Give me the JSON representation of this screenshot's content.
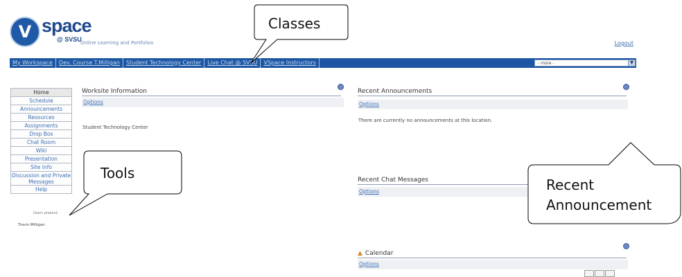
{
  "header": {
    "logo_mark": "V",
    "logo_main": "space",
    "logo_sub": "@ SVSU",
    "logo_tagline": "Online Learning and Portfolios",
    "logout": "Logout"
  },
  "site_tabs": [
    "My Workspace",
    "Dev. Course T.Milligan",
    "Student Technology Center",
    "Live Chat @ SVSU",
    "VSpace Instructors"
  ],
  "more_select": {
    "selected": "- more -"
  },
  "tool_menu": [
    "Home",
    "Schedule",
    "Announcements",
    "Resources",
    "Assignments",
    "Drop Box",
    "Chat Room",
    "Wiki",
    "Presentation",
    "Site Info",
    "Discussion and Private Messages",
    "Help"
  ],
  "users_present": {
    "label": "Users present:",
    "user": "Travis Milligan"
  },
  "worksite_info": {
    "title": "Worksite Information",
    "options": "Options",
    "body": "Student Technology Center"
  },
  "recent_announcements": {
    "title": "Recent Announcements",
    "options": "Options",
    "body": "There are currently no announcements at this location."
  },
  "recent_chat": {
    "title": "Recent Chat Messages",
    "options": "Options"
  },
  "calendar": {
    "title": "Calendar",
    "options": "Options"
  },
  "callouts": {
    "classes": "Classes",
    "tools": "Tools",
    "announcement_line1": "Recent",
    "announcement_line2": "Announcement"
  },
  "colors": {
    "site_bar": "#1d57a3",
    "link": "#3a6db3",
    "options_bg": "#eef0f4"
  }
}
